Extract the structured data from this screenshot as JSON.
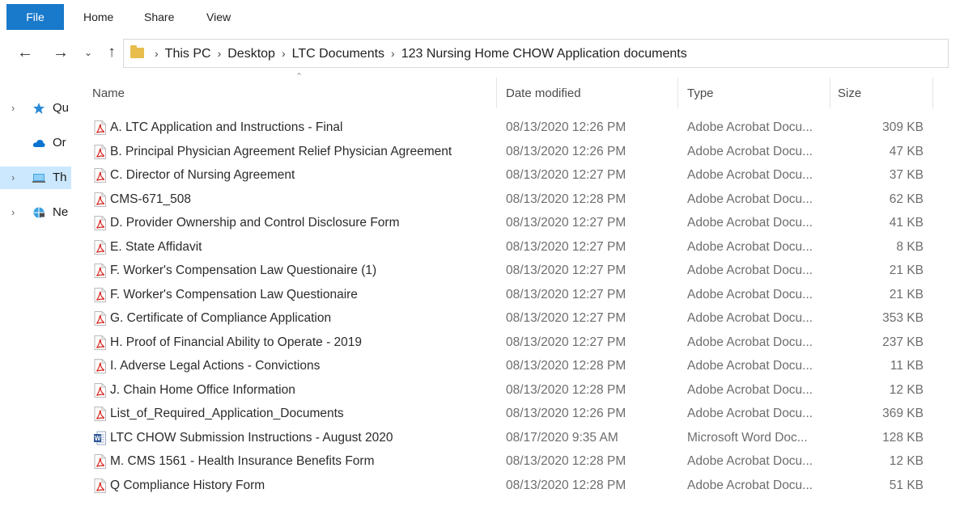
{
  "ribbon": {
    "tabs": [
      "File",
      "Home",
      "Share",
      "View"
    ]
  },
  "navigation": {
    "back_icon": "arrow-left-icon",
    "forward_icon": "arrow-right-icon",
    "recent_icon": "chevron-down-icon",
    "up_icon": "arrow-up-icon"
  },
  "address": {
    "crumbs": [
      "This PC",
      "Desktop",
      "LTC Documents",
      "123 Nursing Home CHOW Application documents"
    ]
  },
  "sidebar": {
    "items": [
      {
        "label": "Qu",
        "icon": "star-icon",
        "chevron": true,
        "selected": false
      },
      {
        "label": "Or",
        "icon": "cloud-icon",
        "chevron": false,
        "selected": false
      },
      {
        "label": "Th",
        "icon": "computer-icon",
        "chevron": true,
        "selected": true
      },
      {
        "label": "Ne",
        "icon": "network-icon",
        "chevron": true,
        "selected": false
      }
    ]
  },
  "columns": {
    "name": "Name",
    "date": "Date modified",
    "type": "Type",
    "size": "Size"
  },
  "files": [
    {
      "name": "A. LTC Application and Instructions - Final",
      "date": "08/13/2020 12:26 PM",
      "type": "Adobe Acrobat Docu...",
      "size": "309 KB",
      "icon": "pdf-icon"
    },
    {
      "name": "B. Principal Physician Agreement Relief Physician Agreement",
      "date": "08/13/2020 12:26 PM",
      "type": "Adobe Acrobat Docu...",
      "size": "47 KB",
      "icon": "pdf-icon"
    },
    {
      "name": "C. Director of Nursing Agreement",
      "date": "08/13/2020 12:27 PM",
      "type": "Adobe Acrobat Docu...",
      "size": "37 KB",
      "icon": "pdf-icon"
    },
    {
      "name": "CMS-671_508",
      "date": "08/13/2020 12:28 PM",
      "type": "Adobe Acrobat Docu...",
      "size": "62 KB",
      "icon": "pdf-icon"
    },
    {
      "name": "D. Provider Ownership and Control Disclosure Form",
      "date": "08/13/2020 12:27 PM",
      "type": "Adobe Acrobat Docu...",
      "size": "41 KB",
      "icon": "pdf-icon"
    },
    {
      "name": "E. State Affidavit",
      "date": "08/13/2020 12:27 PM",
      "type": "Adobe Acrobat Docu...",
      "size": "8 KB",
      "icon": "pdf-icon"
    },
    {
      "name": "F. Worker's Compensation Law Questionaire (1)",
      "date": "08/13/2020 12:27 PM",
      "type": "Adobe Acrobat Docu...",
      "size": "21 KB",
      "icon": "pdf-icon"
    },
    {
      "name": "F. Worker's Compensation Law Questionaire",
      "date": "08/13/2020 12:27 PM",
      "type": "Adobe Acrobat Docu...",
      "size": "21 KB",
      "icon": "pdf-icon"
    },
    {
      "name": "G. Certificate of Compliance Application",
      "date": "08/13/2020 12:27 PM",
      "type": "Adobe Acrobat Docu...",
      "size": "353 KB",
      "icon": "pdf-icon"
    },
    {
      "name": "H. Proof of Financial Ability to Operate - 2019",
      "date": "08/13/2020 12:27 PM",
      "type": "Adobe Acrobat Docu...",
      "size": "237 KB",
      "icon": "pdf-icon"
    },
    {
      "name": "I. Adverse Legal Actions - Convictions",
      "date": "08/13/2020 12:28 PM",
      "type": "Adobe Acrobat Docu...",
      "size": "11 KB",
      "icon": "pdf-icon"
    },
    {
      "name": "J. Chain Home Office Information",
      "date": "08/13/2020 12:28 PM",
      "type": "Adobe Acrobat Docu...",
      "size": "12 KB",
      "icon": "pdf-icon"
    },
    {
      "name": "List_of_Required_Application_Documents",
      "date": "08/13/2020 12:26 PM",
      "type": "Adobe Acrobat Docu...",
      "size": "369 KB",
      "icon": "pdf-icon"
    },
    {
      "name": "LTC CHOW Submission Instructions - August 2020",
      "date": "08/17/2020 9:35 AM",
      "type": "Microsoft Word Doc...",
      "size": "128 KB",
      "icon": "word-doc-icon"
    },
    {
      "name": "M. CMS 1561 - Health Insurance Benefits Form",
      "date": "08/13/2020 12:28 PM",
      "type": "Adobe Acrobat Docu...",
      "size": "12 KB",
      "icon": "pdf-icon"
    },
    {
      "name": "Q Compliance History Form",
      "date": "08/13/2020 12:28 PM",
      "type": "Adobe Acrobat Docu...",
      "size": "51 KB",
      "icon": "pdf-icon"
    }
  ],
  "colors": {
    "file_tab": "#1979ca",
    "selected_nav": "#cce8ff",
    "pdf_red": "#d7261e",
    "word_blue": "#2b5797",
    "folder_yellow": "#e8bd4d"
  }
}
